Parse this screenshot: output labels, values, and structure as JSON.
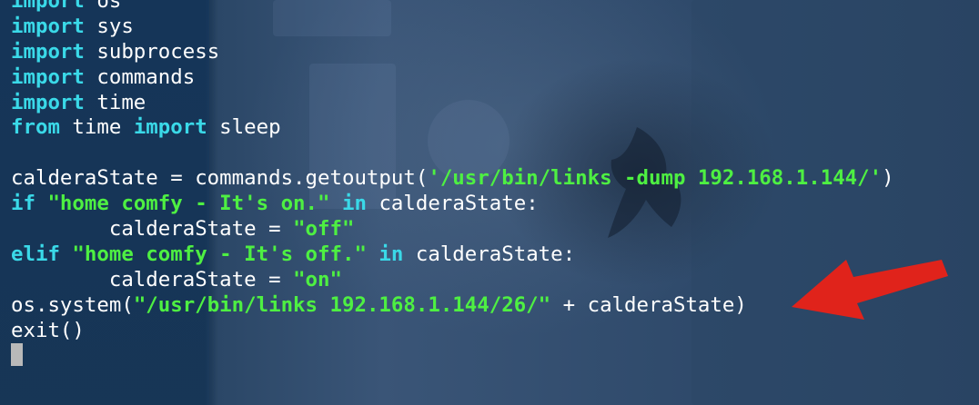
{
  "terminal": {
    "lines": [
      [
        {
          "t": "kw",
          "v": "import"
        },
        {
          "t": "txt",
          "v": " os"
        }
      ],
      [
        {
          "t": "kw",
          "v": "import"
        },
        {
          "t": "txt",
          "v": " sys"
        }
      ],
      [
        {
          "t": "kw",
          "v": "import"
        },
        {
          "t": "txt",
          "v": " subprocess"
        }
      ],
      [
        {
          "t": "kw",
          "v": "import"
        },
        {
          "t": "txt",
          "v": " commands"
        }
      ],
      [
        {
          "t": "kw",
          "v": "import"
        },
        {
          "t": "txt",
          "v": " time"
        }
      ],
      [
        {
          "t": "kw",
          "v": "from"
        },
        {
          "t": "txt",
          "v": " time "
        },
        {
          "t": "kw",
          "v": "import"
        },
        {
          "t": "txt",
          "v": " sleep"
        }
      ],
      [],
      [
        {
          "t": "txt",
          "v": "calderaState = commands.getoutput("
        },
        {
          "t": "str",
          "v": "'/usr/bin/links -dump 192.168.1.144/'"
        },
        {
          "t": "txt",
          "v": ")"
        }
      ],
      [
        {
          "t": "kw",
          "v": "if"
        },
        {
          "t": "txt",
          "v": " "
        },
        {
          "t": "str",
          "v": "\"home comfy - It's on.\""
        },
        {
          "t": "txt",
          "v": " "
        },
        {
          "t": "kw",
          "v": "in"
        },
        {
          "t": "txt",
          "v": " calderaState:"
        }
      ],
      [
        {
          "t": "txt",
          "v": "        calderaState = "
        },
        {
          "t": "str",
          "v": "\"off\""
        }
      ],
      [
        {
          "t": "kw",
          "v": "elif"
        },
        {
          "t": "txt",
          "v": " "
        },
        {
          "t": "str",
          "v": "\"home comfy - It's off.\""
        },
        {
          "t": "txt",
          "v": " "
        },
        {
          "t": "kw",
          "v": "in"
        },
        {
          "t": "txt",
          "v": " calderaState:"
        }
      ],
      [
        {
          "t": "txt",
          "v": "        calderaState = "
        },
        {
          "t": "str",
          "v": "\"on\""
        }
      ],
      [
        {
          "t": "txt",
          "v": "os.system("
        },
        {
          "t": "str",
          "v": "\"/usr/bin/links 192.168.1.144/26/\""
        },
        {
          "t": "txt",
          "v": " + calderaState)"
        }
      ],
      [
        {
          "t": "txt",
          "v": "exit()"
        }
      ]
    ]
  },
  "colors": {
    "keyword": "#3ad9e8",
    "string": "#4ef042",
    "text": "#ffffff",
    "arrow": "#e0231b",
    "cursor": "#b9b9b9"
  },
  "annotation": {
    "icon": "red-arrow-icon"
  }
}
